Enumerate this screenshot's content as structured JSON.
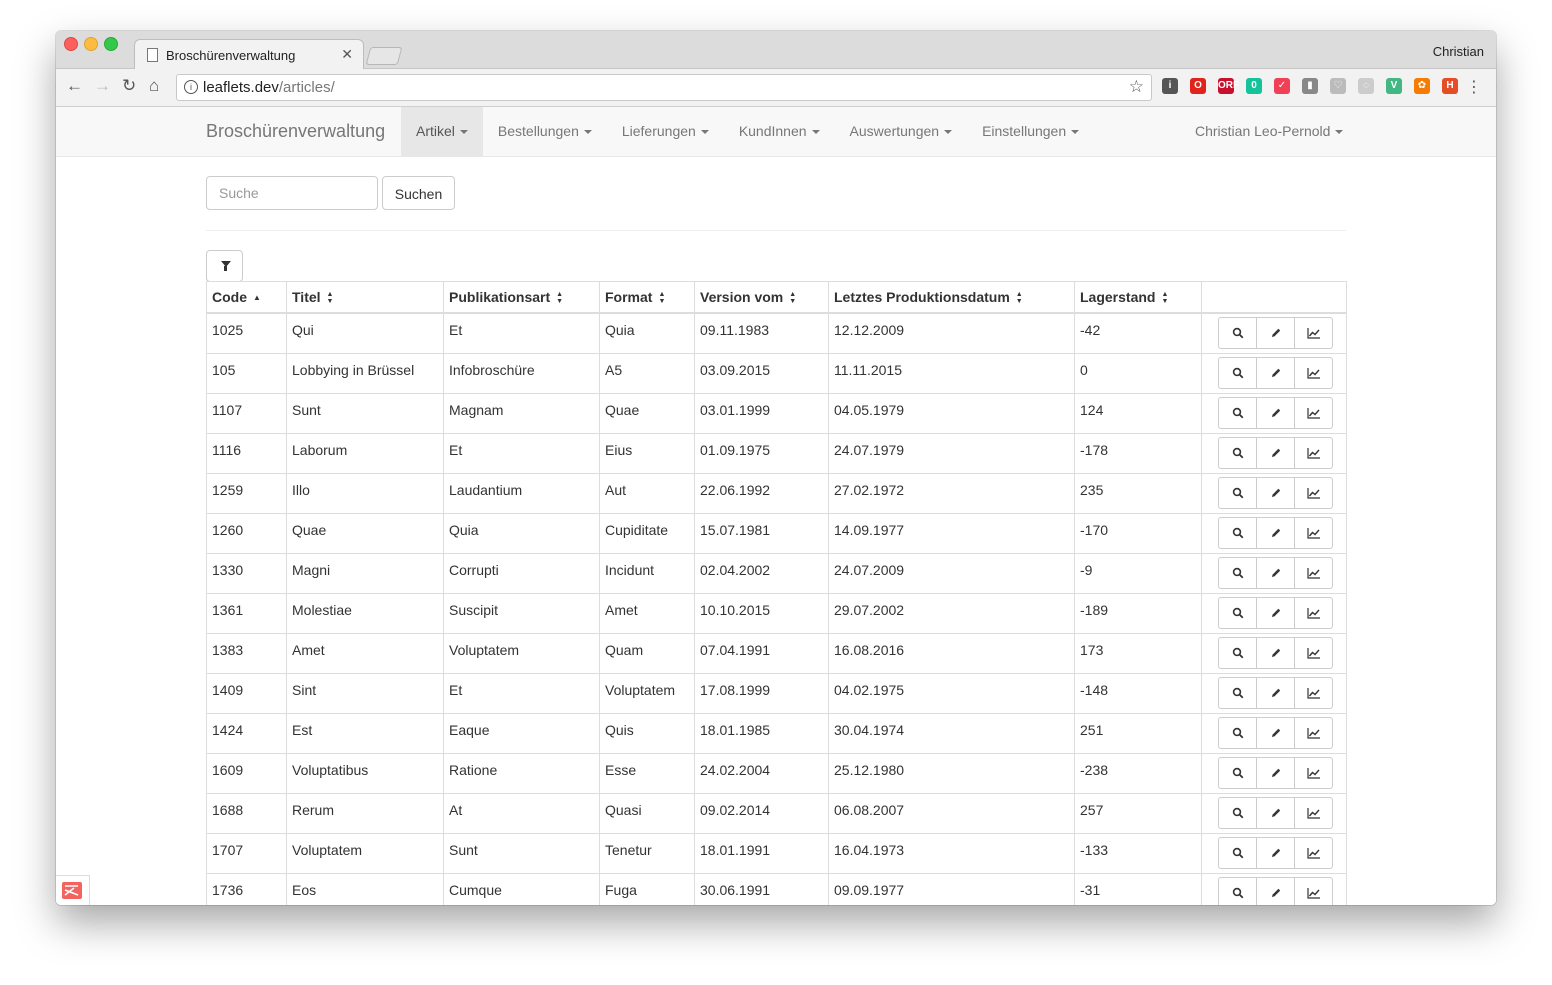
{
  "browser": {
    "tab_title": "Broschürenverwaltung",
    "tab_close": "✕",
    "profile_name": "Christian",
    "url_host": "leaflets.dev",
    "url_path": "/articles/",
    "back": "←",
    "forward": "→",
    "reload": "↻",
    "home": "⌂",
    "star": "☆",
    "menu": "⋮",
    "extensions": [
      {
        "icon": "onepassword-icon",
        "label": "i",
        "color": "#555555"
      },
      {
        "icon": "opera-icon",
        "label": "O",
        "color": "#e0241b"
      },
      {
        "icon": "orf-icon",
        "label": "ORF",
        "color": "#c8102e"
      },
      {
        "icon": "grammarly-icon",
        "label": "0",
        "color": "#15c39a"
      },
      {
        "icon": "pocket-icon",
        "label": "✓",
        "color": "#ef4056"
      },
      {
        "icon": "bookmark-icon",
        "label": "▮",
        "color": "#888888"
      },
      {
        "icon": "heart-icon",
        "label": "♡",
        "color": "#bbbbbb"
      },
      {
        "icon": "ghost-icon",
        "label": "◌",
        "color": "#cccccc"
      },
      {
        "icon": "vue-icon",
        "label": "V",
        "color": "#41b883"
      },
      {
        "icon": "orange-extension-icon",
        "label": "✿",
        "color": "#f57c00"
      },
      {
        "icon": "html-validator-icon",
        "label": "H",
        "color": "#e44d26"
      }
    ]
  },
  "navbar": {
    "brand": "Broschürenverwaltung",
    "items": [
      {
        "label": "Artikel",
        "active": true
      },
      {
        "label": "Bestellungen",
        "active": false
      },
      {
        "label": "Lieferungen",
        "active": false
      },
      {
        "label": "KundInnen",
        "active": false
      },
      {
        "label": "Auswertungen",
        "active": false
      },
      {
        "label": "Einstellungen",
        "active": false
      }
    ],
    "user": "Christian Leo-Pernold"
  },
  "search": {
    "placeholder": "Suche",
    "value": "",
    "button_label": "Suchen"
  },
  "table": {
    "columns": [
      {
        "label": "Code",
        "sort": "asc"
      },
      {
        "label": "Titel",
        "sort": "both"
      },
      {
        "label": "Publikationsart",
        "sort": "both"
      },
      {
        "label": "Format",
        "sort": "both"
      },
      {
        "label": "Version vom",
        "sort": "both"
      },
      {
        "label": "Letztes Produktionsdatum",
        "sort": "both"
      },
      {
        "label": "Lagerstand",
        "sort": "both"
      },
      {
        "label": "",
        "sort": "none"
      }
    ],
    "rows": [
      [
        "1025",
        "Qui",
        "Et",
        "Quia",
        "09.11.1983",
        "12.12.2009",
        "-42"
      ],
      [
        "105",
        "Lobbying in Brüssel",
        "Infobroschüre",
        "A5",
        "03.09.2015",
        "11.11.2015",
        "0"
      ],
      [
        "1107",
        "Sunt",
        "Magnam",
        "Quae",
        "03.01.1999",
        "04.05.1979",
        "124"
      ],
      [
        "1116",
        "Laborum",
        "Et",
        "Eius",
        "01.09.1975",
        "24.07.1979",
        "-178"
      ],
      [
        "1259",
        "Illo",
        "Laudantium",
        "Aut",
        "22.06.1992",
        "27.02.1972",
        "235"
      ],
      [
        "1260",
        "Quae",
        "Quia",
        "Cupiditate",
        "15.07.1981",
        "14.09.1977",
        "-170"
      ],
      [
        "1330",
        "Magni",
        "Corrupti",
        "Incidunt",
        "02.04.2002",
        "24.07.2009",
        "-9"
      ],
      [
        "1361",
        "Molestiae",
        "Suscipit",
        "Amet",
        "10.10.2015",
        "29.07.2002",
        "-189"
      ],
      [
        "1383",
        "Amet",
        "Voluptatem",
        "Quam",
        "07.04.1991",
        "16.08.2016",
        "173"
      ],
      [
        "1409",
        "Sint",
        "Et",
        "Voluptatem",
        "17.08.1999",
        "04.02.1975",
        "-148"
      ],
      [
        "1424",
        "Est",
        "Eaque",
        "Quis",
        "18.01.1985",
        "30.04.1974",
        "251"
      ],
      [
        "1609",
        "Voluptatibus",
        "Ratione",
        "Esse",
        "24.02.2004",
        "25.12.1980",
        "-238"
      ],
      [
        "1688",
        "Rerum",
        "At",
        "Quasi",
        "09.02.2014",
        "06.08.2007",
        "257"
      ],
      [
        "1707",
        "Voluptatem",
        "Sunt",
        "Tenetur",
        "18.01.1991",
        "16.04.1973",
        "-133"
      ],
      [
        "1736",
        "Eos",
        "Cumque",
        "Fuga",
        "30.06.1991",
        "09.09.1977",
        "-31"
      ]
    ],
    "row_actions": [
      "view-icon",
      "edit-icon",
      "stats-icon"
    ]
  }
}
